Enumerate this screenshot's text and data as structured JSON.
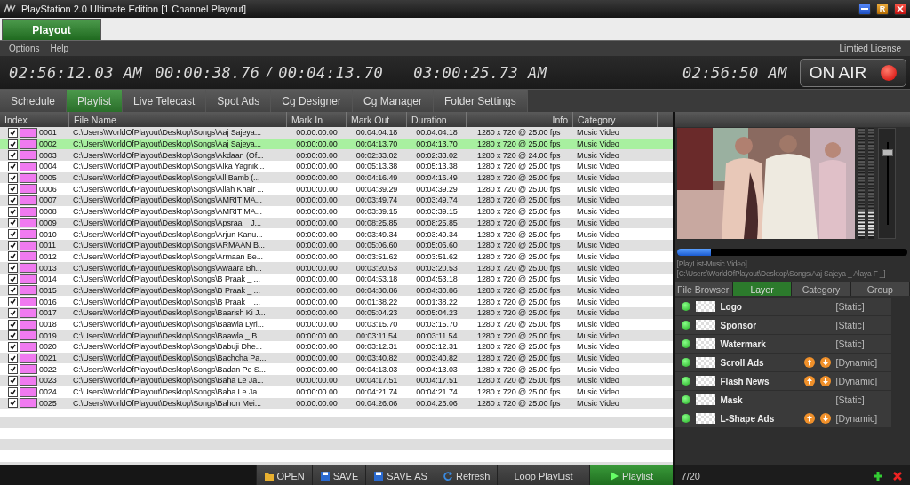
{
  "window": {
    "title": "PlayStation 2.0 Ultimate Edition [1 Channel Playout]",
    "buttons": [
      {
        "kind": "minimize"
      },
      {
        "kind": "restore",
        "label": "R"
      },
      {
        "kind": "close"
      }
    ]
  },
  "mode_tabs": [
    {
      "label": "Playout",
      "selected": true
    }
  ],
  "menu": [
    "Options",
    "Help"
  ],
  "license": "Limtied License",
  "clocks": {
    "current": "02:56:12.03 AM",
    "elapsed": "00:00:38.76",
    "separator": "/",
    "total": "00:04:13.70",
    "end": "03:00:25.73 AM",
    "system": "02:56:50 AM"
  },
  "on_air": {
    "label": "ON AIR",
    "on": true
  },
  "tabs": [
    {
      "label": "Schedule",
      "selected": false
    },
    {
      "label": "Playlist",
      "selected": true
    },
    {
      "label": "Live Telecast",
      "selected": false
    },
    {
      "label": "Spot Ads",
      "selected": false
    },
    {
      "label": "Cg Designer",
      "selected": false
    },
    {
      "label": "Cg Manager",
      "selected": false
    },
    {
      "label": "Folder Settings",
      "selected": false
    }
  ],
  "table": {
    "columns": [
      "Index",
      "File Name",
      "Mark In",
      "Mark Out",
      "Duration",
      "Info",
      "Category"
    ],
    "rows": [
      {
        "index": "0001",
        "file": "C:\\Users\\WorldOfPlayout\\Desktop\\Songs\\Aaj Sajeya...",
        "mark_in": "00:00:00.00",
        "mark_out": "00:04:04.18",
        "duration": "00:04:04.18",
        "info": "1280 x 720 @ 25.00 fps",
        "category": "Music Video",
        "checked": true,
        "selected": false
      },
      {
        "index": "0002",
        "file": "C:\\Users\\WorldOfPlayout\\Desktop\\Songs\\Aaj Sajeya...",
        "mark_in": "00:00:00.00",
        "mark_out": "00:04:13.70",
        "duration": "00:04:13.70",
        "info": "1280 x 720 @ 25.00 fps",
        "category": "Music Video",
        "checked": true,
        "selected": true
      },
      {
        "index": "0003",
        "file": "C:\\Users\\WorldOfPlayout\\Desktop\\Songs\\Akdaan (Of...",
        "mark_in": "00:00:00.00",
        "mark_out": "00:02:33.02",
        "duration": "00:02:33.02",
        "info": "1280 x 720 @ 24.00 fps",
        "category": "Music Video",
        "checked": true,
        "selected": false
      },
      {
        "index": "0004",
        "file": "C:\\Users\\WorldOfPlayout\\Desktop\\Songs\\Alka Yagnik...",
        "mark_in": "00:00:00.00",
        "mark_out": "00:05:13.38",
        "duration": "00:05:13.38",
        "info": "1280 x 720 @ 25.00 fps",
        "category": "Music Video",
        "checked": true,
        "selected": false
      },
      {
        "index": "0005",
        "file": "C:\\Users\\WorldOfPlayout\\Desktop\\Songs\\All Bamb (...",
        "mark_in": "00:00:00.00",
        "mark_out": "00:04:16.49",
        "duration": "00:04:16.49",
        "info": "1280 x 720 @ 25.00 fps",
        "category": "Music Video",
        "checked": true,
        "selected": false
      },
      {
        "index": "0006",
        "file": "C:\\Users\\WorldOfPlayout\\Desktop\\Songs\\Allah Khair ...",
        "mark_in": "00:00:00.00",
        "mark_out": "00:04:39.29",
        "duration": "00:04:39.29",
        "info": "1280 x 720 @ 25.00 fps",
        "category": "Music Video",
        "checked": true,
        "selected": false
      },
      {
        "index": "0007",
        "file": "C:\\Users\\WorldOfPlayout\\Desktop\\Songs\\AMRIT MA...",
        "mark_in": "00:00:00.00",
        "mark_out": "00:03:49.74",
        "duration": "00:03:49.74",
        "info": "1280 x 720 @ 25.00 fps",
        "category": "Music Video",
        "checked": true,
        "selected": false
      },
      {
        "index": "0008",
        "file": "C:\\Users\\WorldOfPlayout\\Desktop\\Songs\\AMRIT MA...",
        "mark_in": "00:00:00.00",
        "mark_out": "00:03:39.15",
        "duration": "00:03:39.15",
        "info": "1280 x 720 @ 25.00 fps",
        "category": "Music Video",
        "checked": true,
        "selected": false
      },
      {
        "index": "0009",
        "file": "C:\\Users\\WorldOfPlayout\\Desktop\\Songs\\Apsraa _ J...",
        "mark_in": "00:00:00.00",
        "mark_out": "00:08:25.85",
        "duration": "00:08:25.85",
        "info": "1280 x 720 @ 25.00 fps",
        "category": "Music Video",
        "checked": true,
        "selected": false
      },
      {
        "index": "0010",
        "file": "C:\\Users\\WorldOfPlayout\\Desktop\\Songs\\Arjun Kanu...",
        "mark_in": "00:00:00.00",
        "mark_out": "00:03:49.34",
        "duration": "00:03:49.34",
        "info": "1280 x 720 @ 25.00 fps",
        "category": "Music Video",
        "checked": true,
        "selected": false
      },
      {
        "index": "0011",
        "file": "C:\\Users\\WorldOfPlayout\\Desktop\\Songs\\ARMAAN B...",
        "mark_in": "00:00:00.00",
        "mark_out": "00:05:06.60",
        "duration": "00:05:06.60",
        "info": "1280 x 720 @ 25.00 fps",
        "category": "Music Video",
        "checked": true,
        "selected": false
      },
      {
        "index": "0012",
        "file": "C:\\Users\\WorldOfPlayout\\Desktop\\Songs\\Armaan Be...",
        "mark_in": "00:00:00.00",
        "mark_out": "00:03:51.62",
        "duration": "00:03:51.62",
        "info": "1280 x 720 @ 25.00 fps",
        "category": "Music Video",
        "checked": true,
        "selected": false
      },
      {
        "index": "0013",
        "file": "C:\\Users\\WorldOfPlayout\\Desktop\\Songs\\Awaara Bh...",
        "mark_in": "00:00:00.00",
        "mark_out": "00:03:20.53",
        "duration": "00:03:20.53",
        "info": "1280 x 720 @ 25.00 fps",
        "category": "Music Video",
        "checked": true,
        "selected": false
      },
      {
        "index": "0014",
        "file": "C:\\Users\\WorldOfPlayout\\Desktop\\Songs\\B Praak _ ...",
        "mark_in": "00:00:00.00",
        "mark_out": "00:04:53.18",
        "duration": "00:04:53.18",
        "info": "1280 x 720 @ 25.00 fps",
        "category": "Music Video",
        "checked": true,
        "selected": false
      },
      {
        "index": "0015",
        "file": "C:\\Users\\WorldOfPlayout\\Desktop\\Songs\\B Praak _ ...",
        "mark_in": "00:00:00.00",
        "mark_out": "00:04:30.86",
        "duration": "00:04:30.86",
        "info": "1280 x 720 @ 25.00 fps",
        "category": "Music Video",
        "checked": true,
        "selected": false
      },
      {
        "index": "0016",
        "file": "C:\\Users\\WorldOfPlayout\\Desktop\\Songs\\B Praak _ ...",
        "mark_in": "00:00:00.00",
        "mark_out": "00:01:38.22",
        "duration": "00:01:38.22",
        "info": "1280 x 720 @ 25.00 fps",
        "category": "Music Video",
        "checked": true,
        "selected": false
      },
      {
        "index": "0017",
        "file": "C:\\Users\\WorldOfPlayout\\Desktop\\Songs\\Baarish Ki J...",
        "mark_in": "00:00:00.00",
        "mark_out": "00:05:04.23",
        "duration": "00:05:04.23",
        "info": "1280 x 720 @ 25.00 fps",
        "category": "Music Video",
        "checked": true,
        "selected": false
      },
      {
        "index": "0018",
        "file": "C:\\Users\\WorldOfPlayout\\Desktop\\Songs\\Baawla Lyri...",
        "mark_in": "00:00:00.00",
        "mark_out": "00:03:15.70",
        "duration": "00:03:15.70",
        "info": "1280 x 720 @ 25.00 fps",
        "category": "Music Video",
        "checked": true,
        "selected": false
      },
      {
        "index": "0019",
        "file": "C:\\Users\\WorldOfPlayout\\Desktop\\Songs\\Baawla _ B...",
        "mark_in": "00:00:00.00",
        "mark_out": "00:03:11.54",
        "duration": "00:03:11.54",
        "info": "1280 x 720 @ 25.00 fps",
        "category": "Music Video",
        "checked": true,
        "selected": false
      },
      {
        "index": "0020",
        "file": "C:\\Users\\WorldOfPlayout\\Desktop\\Songs\\Babuji Dhe...",
        "mark_in": "00:00:00.00",
        "mark_out": "00:03:12.31",
        "duration": "00:03:12.31",
        "info": "1280 x 720 @ 25.00 fps",
        "category": "Music Video",
        "checked": true,
        "selected": false
      },
      {
        "index": "0021",
        "file": "C:\\Users\\WorldOfPlayout\\Desktop\\Songs\\Bachcha Pa...",
        "mark_in": "00:00:00.00",
        "mark_out": "00:03:40.82",
        "duration": "00:03:40.82",
        "info": "1280 x 720 @ 25.00 fps",
        "category": "Music Video",
        "checked": true,
        "selected": false
      },
      {
        "index": "0022",
        "file": "C:\\Users\\WorldOfPlayout\\Desktop\\Songs\\Badan Pe S...",
        "mark_in": "00:00:00.00",
        "mark_out": "00:04:13.03",
        "duration": "00:04:13.03",
        "info": "1280 x 720 @ 25.00 fps",
        "category": "Music Video",
        "checked": true,
        "selected": false
      },
      {
        "index": "0023",
        "file": "C:\\Users\\WorldOfPlayout\\Desktop\\Songs\\Baha Le Ja...",
        "mark_in": "00:00:00.00",
        "mark_out": "00:04:17.51",
        "duration": "00:04:17.51",
        "info": "1280 x 720 @ 25.00 fps",
        "category": "Music Video",
        "checked": true,
        "selected": false
      },
      {
        "index": "0024",
        "file": "C:\\Users\\WorldOfPlayout\\Desktop\\Songs\\Baha Le Ja...",
        "mark_in": "00:00:00.00",
        "mark_out": "00:04:21.74",
        "duration": "00:04:21.74",
        "info": "1280 x 720 @ 25.00 fps",
        "category": "Music Video",
        "checked": true,
        "selected": false
      },
      {
        "index": "0025",
        "file": "C:\\Users\\WorldOfPlayout\\Desktop\\Songs\\Bahon Mei...",
        "mark_in": "00:00:00.00",
        "mark_out": "00:04:26.06",
        "duration": "00:04:26.06",
        "info": "1280 x 720 @ 25.00 fps",
        "category": "Music Video",
        "checked": true,
        "selected": false
      }
    ]
  },
  "toolbar": [
    {
      "kind": "open",
      "label": "OPEN"
    },
    {
      "kind": "save",
      "label": "SAVE"
    },
    {
      "kind": "save",
      "label": "SAVE AS"
    },
    {
      "kind": "refresh",
      "label": "Refresh"
    },
    {
      "kind": "plain",
      "label": "Loop PlayList"
    },
    {
      "kind": "play",
      "label": "Playlist"
    }
  ],
  "preview": {
    "progress": {
      "level": 0.15
    },
    "volume": {
      "level": 0.8
    },
    "now_playing": [
      "[PlayList-Music Video]",
      "[C:\\Users\\WorldOfPlayout\\Desktop\\Songs\\Aaj Sajeya _ Alaya F _]"
    ]
  },
  "panel_tabs": [
    {
      "label": "File Browser",
      "selected": false
    },
    {
      "label": "Layer",
      "selected": true
    },
    {
      "label": "Category",
      "selected": false
    },
    {
      "label": "Group",
      "selected": false
    }
  ],
  "layers": [
    {
      "name": "Logo",
      "type": "[Static]",
      "kind": "static",
      "on": true
    },
    {
      "name": "Sponsor",
      "type": "[Static]",
      "kind": "static",
      "on": true
    },
    {
      "name": "Watermark",
      "type": "[Static]",
      "kind": "static",
      "on": true
    },
    {
      "name": "Scroll Ads",
      "type": "[Dynamic]",
      "kind": "dynamic",
      "on": true
    },
    {
      "name": "Flash News",
      "type": "[Dynamic]",
      "kind": "dynamic",
      "on": true
    },
    {
      "name": "Mask",
      "type": "[Static]",
      "kind": "static",
      "on": true
    },
    {
      "name": "L-Shape Ads",
      "type": "[Dynamic]",
      "kind": "dynamic",
      "on": true
    }
  ],
  "layer_count": "7/20"
}
